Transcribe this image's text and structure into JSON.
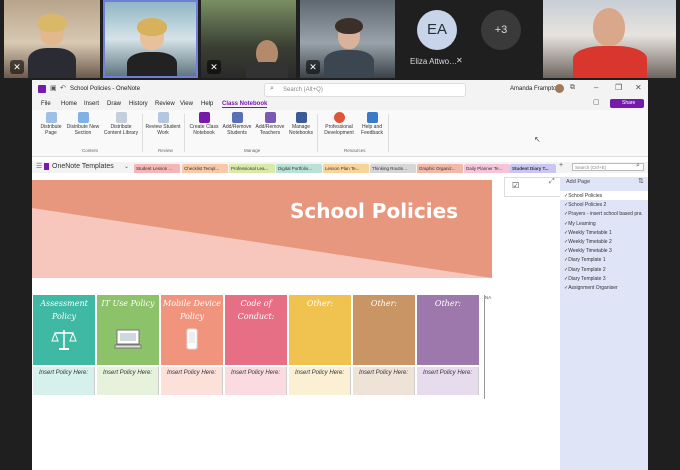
{
  "meeting": {
    "ea_initials": "EA",
    "ea_name": "Eliza Attwo…",
    "overflow_count": "+3"
  },
  "window": {
    "title": "School Policies - OneNote",
    "search_placeholder": "Search (Alt+Q)",
    "user_name": "Amanda Frampton",
    "share_label": "Share"
  },
  "menu": [
    "File",
    "Home",
    "Insert",
    "Draw",
    "History",
    "Review",
    "View",
    "Help",
    "Class Notebook"
  ],
  "ribbon": {
    "buttons": [
      {
        "label": "Distribute Page"
      },
      {
        "label": "Distribute New Section"
      },
      {
        "label": "Distribute Content Library"
      },
      {
        "label": "Review Student Work"
      },
      {
        "label": "Create Class Notebook"
      },
      {
        "label": "Add/Remove Students"
      },
      {
        "label": "Add/Remove Teachers"
      },
      {
        "label": "Manage Notebooks"
      },
      {
        "label": "Professional Development"
      },
      {
        "label": "Help and Feedback"
      }
    ],
    "groups": [
      "Content",
      "Review",
      "Manage",
      "Resources"
    ]
  },
  "notebook": {
    "name": "OneNote Templates",
    "tabs": [
      {
        "label": "Student Lesson ...",
        "color": "#f4b6b6"
      },
      {
        "label": "Checklist Templ...",
        "color": "#f7c9a8"
      },
      {
        "label": "Professional Lea...",
        "color": "#d8e9a8"
      },
      {
        "label": "Digital Portfolio...",
        "color": "#b9e1d5"
      },
      {
        "label": "Lesson Plan Te...",
        "color": "#f9d49a"
      },
      {
        "label": "Thinking Routin...",
        "color": "#d6d6d6"
      },
      {
        "label": "Graphic Organiz...",
        "color": "#f2b8a8"
      },
      {
        "label": "Daily Planner Te...",
        "color": "#f6c4d8"
      },
      {
        "label": "Student Diary T...",
        "color": "#c9c6ef"
      }
    ],
    "search_placeholder": "Search (Ctrl+E)"
  },
  "page": {
    "title": "School Policies",
    "columns": [
      {
        "header": "Assessment Policy",
        "color": "#3fb8a4",
        "cell_color": "#d6f0eb",
        "icon": "scale-icon"
      },
      {
        "header": "IT Use Policy",
        "color": "#8cc26a",
        "cell_color": "#e6f2dc",
        "icon": "computer-icon"
      },
      {
        "header": "Mobile Device Policy",
        "color": "#f0947e",
        "cell_color": "#fbe1da",
        "icon": "phone-icon"
      },
      {
        "header": "Code of Conduct:",
        "color": "#e66f86",
        "cell_color": "#f9dbe1",
        "icon": ""
      },
      {
        "header": "Other:",
        "color": "#f0c24f",
        "cell_color": "#fbf0d4",
        "icon": ""
      },
      {
        "header": "Other:",
        "color": "#c99564",
        "cell_color": "#efe2d6",
        "icon": ""
      },
      {
        "header": "Other:",
        "color": "#9c78ad",
        "cell_color": "#e7dcee",
        "icon": ""
      }
    ],
    "cell_text": "Insert Policy Here:",
    "side_note": "NA"
  },
  "pages_pane": {
    "add_label": "Add Page",
    "items": [
      "School Policies",
      "School Policies 2",
      "Prayers - insert school based pra",
      "My Learning",
      "Weekly Timetable 1",
      "Weekly Timetable 2",
      "Weekly Timetable 3",
      "Diary Template 1",
      "Diary Template 2",
      "Diary Template 3",
      "Assignment Organiser"
    ]
  }
}
